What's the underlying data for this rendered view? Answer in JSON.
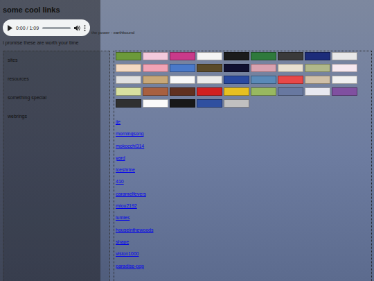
{
  "page": {
    "title": "some cool links",
    "subtitle": "i promise these are worth your time"
  },
  "audio": {
    "time": "0:00 / 1:09",
    "level": 0,
    "playing": false,
    "caption": "the power - earthbound"
  },
  "sidebar": {
    "items": [
      "sites",
      "resources",
      "something special",
      "webrings"
    ]
  },
  "buttons": [
    {
      "color": "#6c9a3a"
    },
    {
      "color": "#f2c9dc"
    },
    {
      "color": "#c93a8a"
    },
    {
      "color": "#f4f4f4"
    },
    {
      "color": "#1b1b1b"
    },
    {
      "color": "#2f7a3c"
    },
    {
      "color": "#3a3a3a"
    },
    {
      "color": "#1c2c7a"
    },
    {
      "color": "#e8e8e8"
    },
    {
      "color": "#f3d9c2"
    },
    {
      "color": "#f0a3b5"
    },
    {
      "color": "#4a79c9"
    },
    {
      "color": "#5a4a2a"
    },
    {
      "color": "#101030"
    },
    {
      "color": "#d9a2b0"
    },
    {
      "color": "#e8e0d0"
    },
    {
      "color": "#b0b88a"
    },
    {
      "color": "#f6e8f0"
    },
    {
      "color": "#e0e0e0"
    },
    {
      "color": "#c8a878"
    },
    {
      "color": "#f8f8f8"
    },
    {
      "color": "#eaeaea"
    },
    {
      "color": "#2a4aa0"
    },
    {
      "color": "#5a8ab8"
    },
    {
      "color": "#e84848"
    },
    {
      "color": "#d0c0a8"
    },
    {
      "color": "#f0f0f0"
    },
    {
      "color": "#d8e0a0"
    },
    {
      "color": "#a86040"
    },
    {
      "color": "#603020"
    },
    {
      "color": "#d02020"
    },
    {
      "color": "#e8c020"
    },
    {
      "color": "#98b860"
    },
    {
      "color": "#6878a0"
    },
    {
      "color": "#e8e8f0"
    },
    {
      "color": "#8050a0"
    },
    {
      "color": "#303030"
    },
    {
      "color": "#fafafa"
    },
    {
      "color": "#181818"
    },
    {
      "color": "#3050a0"
    },
    {
      "color": "#c0c0c0"
    }
  ],
  "links": [
    "jje",
    "morningsong",
    "mokocchi314",
    "yard",
    "iceshrine",
    "410",
    "caramelfevers",
    "miou2192",
    "lumies",
    "houseinthewoods",
    "shape",
    "vision1000",
    "paradise-pop"
  ]
}
